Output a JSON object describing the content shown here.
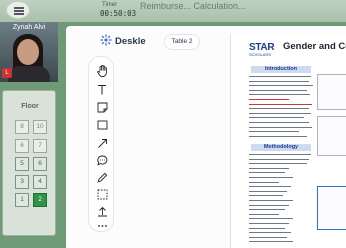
{
  "session": {
    "timer_label": "Timer",
    "timer": "00:50:03",
    "title": "Reimburse...   Calculation..."
  },
  "video": {
    "participant_name": "Zynah Alvi",
    "badge": "L"
  },
  "floor_panel": {
    "label": "Floor",
    "buttons": [
      {
        "label": "8",
        "col": "left",
        "row": 1
      },
      {
        "label": "10",
        "col": "right",
        "row": 1
      },
      {
        "label": "6",
        "col": "left",
        "row": 2
      },
      {
        "label": "7",
        "col": "right",
        "row": 2
      },
      {
        "label": "5",
        "col": "left",
        "row": 3
      },
      {
        "label": "6",
        "col": "right",
        "row": 3
      },
      {
        "label": "3",
        "col": "left",
        "row": 4
      },
      {
        "label": "4",
        "col": "right",
        "row": 4
      },
      {
        "label": "1",
        "col": "left",
        "row": 5
      },
      {
        "label": "2",
        "col": "right",
        "row": 5
      }
    ],
    "current_floor": "2",
    "accent_color": "#2e9447"
  },
  "board": {
    "app_name": "Deskle",
    "tab_label": "Table 2",
    "tools": [
      "hand-icon",
      "text-icon",
      "sticky-note-icon",
      "rectangle-icon",
      "arrow-icon",
      "comment-icon",
      "pen-icon",
      "select-icon",
      "upload-icon",
      "more-icon"
    ]
  },
  "document": {
    "logo": "STAR",
    "logo_sub": "SCHOLARS",
    "title": "Gender and Corr",
    "sections": [
      "Introduction",
      "Methodology"
    ]
  }
}
